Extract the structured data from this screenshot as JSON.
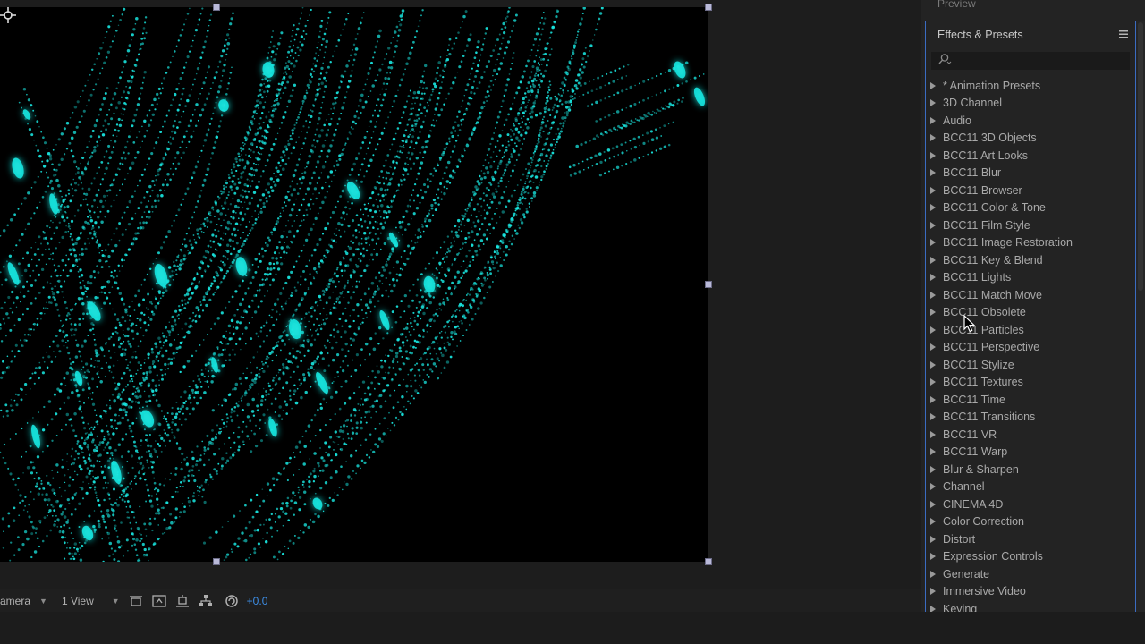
{
  "preview_tab_label": "Preview",
  "effects_panel": {
    "title": "Effects & Presets",
    "search_placeholder": "",
    "items": [
      {
        "label": "* Animation Presets"
      },
      {
        "label": "3D Channel"
      },
      {
        "label": "Audio"
      },
      {
        "label": "BCC11 3D Objects"
      },
      {
        "label": "BCC11 Art Looks"
      },
      {
        "label": "BCC11 Blur"
      },
      {
        "label": "BCC11 Browser"
      },
      {
        "label": "BCC11 Color & Tone"
      },
      {
        "label": "BCC11 Film Style"
      },
      {
        "label": "BCC11 Image Restoration"
      },
      {
        "label": "BCC11 Key & Blend"
      },
      {
        "label": "BCC11 Lights"
      },
      {
        "label": "BCC11 Match Move"
      },
      {
        "label": "BCC11 Obsolete"
      },
      {
        "label": "BCC11 Particles"
      },
      {
        "label": "BCC11 Perspective"
      },
      {
        "label": "BCC11 Stylize"
      },
      {
        "label": "BCC11 Textures"
      },
      {
        "label": "BCC11 Time"
      },
      {
        "label": "BCC11 Transitions"
      },
      {
        "label": "BCC11 VR"
      },
      {
        "label": "BCC11 Warp"
      },
      {
        "label": "Blur & Sharpen"
      },
      {
        "label": "Channel"
      },
      {
        "label": "CINEMA 4D"
      },
      {
        "label": "Color Correction"
      },
      {
        "label": "Distort"
      },
      {
        "label": "Expression Controls"
      },
      {
        "label": "Generate"
      },
      {
        "label": "Immersive Video"
      },
      {
        "label": "Keying"
      }
    ]
  },
  "viewer_toolbar": {
    "camera_label": "amera",
    "view_layout_label": "1 View",
    "exposure_value": "+0.0"
  },
  "colors": {
    "particle": "#19e6e0",
    "panel_focus_border": "#3b6cc2",
    "exposure_text": "#3d8ee6"
  },
  "icons": [
    "search-icon",
    "panel-menu-icon",
    "expand-triangle-icon",
    "toggle-pixel-aspect-icon",
    "fast-previews-icon",
    "timeline-icon",
    "flowchart-icon",
    "reset-exposure-icon",
    "anchor-point-icon",
    "mouse-cursor-icon"
  ]
}
